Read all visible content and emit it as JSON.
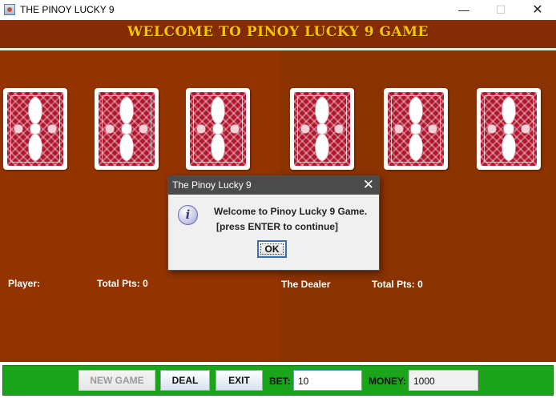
{
  "window": {
    "title": "THE PINOY LUCKY 9",
    "minimize_glyph": "—",
    "maximize_glyph": "☐",
    "close_glyph": "✕"
  },
  "game": {
    "header": "WELCOME TO PINOY LUCKY 9 GAME",
    "player": {
      "label": "Player:",
      "total_label": "Total Pts: 0",
      "cards": [
        "card-back",
        "card-back",
        "card-back"
      ]
    },
    "dealer": {
      "label": "The Dealer",
      "total_label": "Total Pts: 0",
      "cards": [
        "card-back",
        "card-back",
        "card-back"
      ]
    }
  },
  "dialog": {
    "title": "The Pinoy Lucky 9",
    "close_glyph": "✕",
    "icon": "info-icon",
    "icon_glyph": "i",
    "message_line1": "Welcome to Pinoy Lucky 9 Game.",
    "message_line2": "[press ENTER to continue]",
    "ok_label": "OK"
  },
  "controls": {
    "new_game_label": "NEW GAME",
    "new_game_enabled": false,
    "deal_label": "DEAL",
    "exit_label": "EXIT",
    "bet_label": "BET:",
    "bet_value": "10",
    "money_label": "MONEY:",
    "money_value": "1000"
  },
  "colors": {
    "felt_left": "#933400",
    "felt_right": "#8a3200",
    "header_text": "#f5c400",
    "control_bar": "#1aa51a",
    "card_back": "#b0162e"
  }
}
